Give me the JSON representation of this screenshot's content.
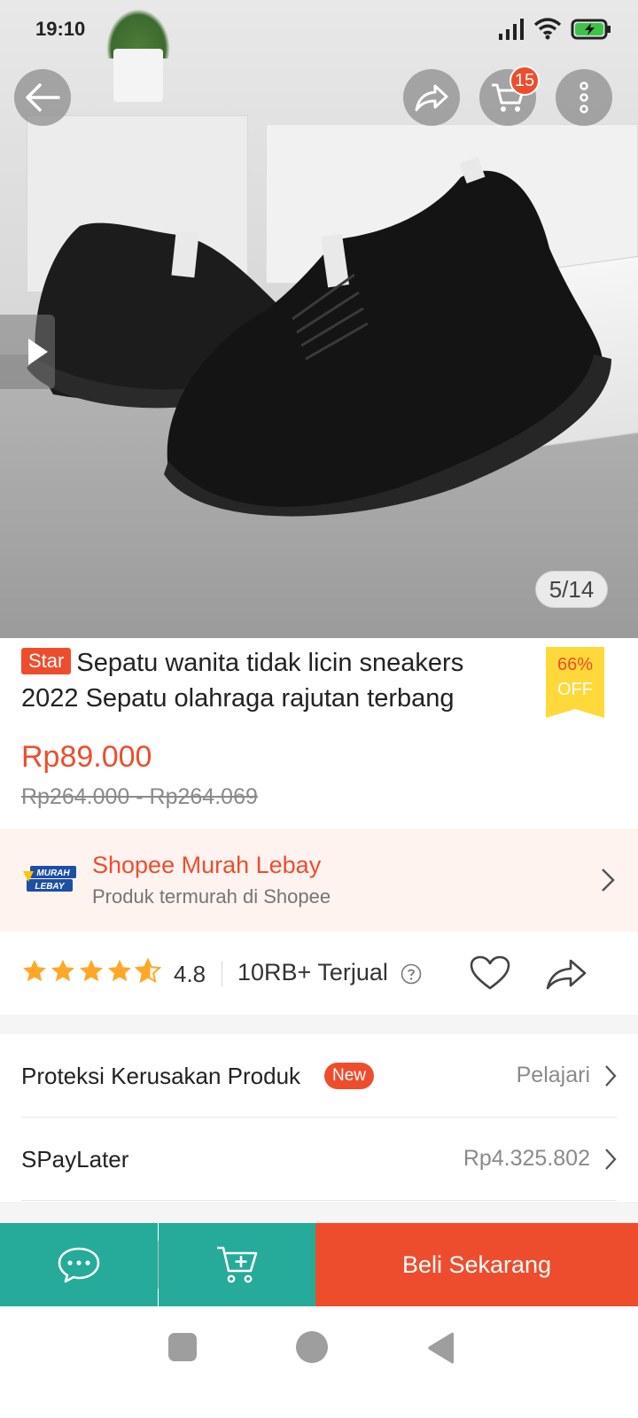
{
  "status_bar": {
    "time": "19:10"
  },
  "top_bar": {
    "cart_count": "15"
  },
  "gallery": {
    "counter": "5/14"
  },
  "product": {
    "badge": "Star",
    "title": "Sepatu wanita tidak licin sneakers 2022 Sepatu olahraga rajutan terbang",
    "discount_percent": "66%",
    "discount_label": "OFF",
    "price": "Rp89.000",
    "original_price": "Rp264.000 - Rp264.069"
  },
  "promo_banner": {
    "logo_text_top": "MURAH",
    "logo_text_bottom": "LEBAY",
    "title": "Shopee Murah Lebay",
    "subtitle": "Produk termurah di Shopee"
  },
  "rating": {
    "stars": 4.8,
    "value": "4.8",
    "sold": "10RB+ Terjual"
  },
  "rows": {
    "protection": {
      "label": "Proteksi Kerusakan Produk",
      "badge": "New",
      "value": "Pelajari"
    },
    "paylater": {
      "label": "SPayLater",
      "value": "Rp4.325.802"
    }
  },
  "action_bar": {
    "buy_label": "Beli Sekarang"
  },
  "colors": {
    "accent": "#ee4d2d",
    "teal": "#26aa99",
    "star": "#ffa726",
    "discount_flag": "#ffd839"
  },
  "icons": [
    "back-arrow-icon",
    "share-icon",
    "cart-icon",
    "more-vertical-icon",
    "play-icon",
    "help-icon",
    "heart-icon",
    "chevron-right-icon",
    "chat-icon",
    "add-to-cart-icon"
  ]
}
